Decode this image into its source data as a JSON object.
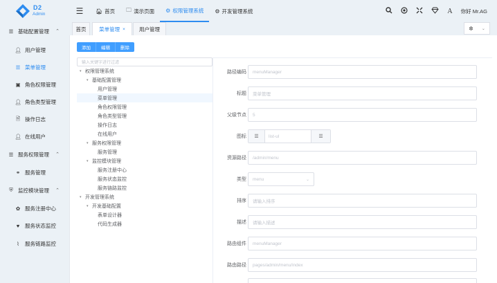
{
  "logo": {
    "title": "D2",
    "subtitle": "Admin"
  },
  "header": {
    "nav": [
      {
        "label": "首页",
        "icon": "home-icon",
        "glyph": "🏠︎"
      },
      {
        "label": "演示页面",
        "icon": "folder-icon",
        "glyph": "🗀"
      },
      {
        "label": "权限管理系统",
        "icon": "github-icon",
        "glyph": "⚙",
        "active": true
      },
      {
        "label": "开发管理系统",
        "icon": "gear-icon",
        "glyph": "⚙"
      }
    ],
    "user": "你好 Mr.AG"
  },
  "sidebar": {
    "items": [
      {
        "label": "基础配置管理",
        "type": "group",
        "icon": "list-icon",
        "glyph": "☰",
        "chevron": "⌃"
      },
      {
        "label": "用户管理",
        "type": "child",
        "icon": "user-icon",
        "glyph": "👤︎"
      },
      {
        "label": "菜单管理",
        "type": "child",
        "icon": "list-ul-icon",
        "glyph": "☰",
        "active": true
      },
      {
        "label": "角色权限管理",
        "type": "child",
        "icon": "id-card-icon",
        "glyph": "▣"
      },
      {
        "label": "角色类型管理",
        "type": "child",
        "icon": "user-secret-icon",
        "glyph": "👤︎"
      },
      {
        "label": "操作日志",
        "type": "child",
        "icon": "file-icon",
        "glyph": "🗎"
      },
      {
        "label": "在线用户",
        "type": "child",
        "icon": "user-icon",
        "glyph": "👤︎"
      },
      {
        "label": "服务权限管理",
        "type": "group",
        "icon": "list-icon",
        "glyph": "☰",
        "chevron": "⌃"
      },
      {
        "label": "服务管理",
        "type": "child",
        "icon": "share-icon",
        "glyph": "⚭"
      },
      {
        "label": "监控模块管理",
        "type": "group",
        "icon": "shield-icon",
        "glyph": "⛨",
        "chevron": "⌃"
      },
      {
        "label": "服务注册中心",
        "type": "child",
        "icon": "paw-icon",
        "glyph": "✿"
      },
      {
        "label": "服务状态监控",
        "type": "child",
        "icon": "heartbeat-icon",
        "glyph": "♥"
      },
      {
        "label": "服务链路监控",
        "type": "child",
        "icon": "line-chart-icon",
        "glyph": "⌇"
      }
    ]
  },
  "tabs": [
    {
      "label": "首页"
    },
    {
      "label": "菜单管理",
      "active": true,
      "close": "×"
    },
    {
      "label": "用户管理"
    }
  ],
  "toolbar": {
    "add": "添加",
    "edit": "编辑",
    "delete": "删除"
  },
  "tree": {
    "filter_placeholder": "输入关键字进行过滤",
    "nodes": [
      {
        "label": "权限管理系统",
        "level": 0,
        "expandable": true
      },
      {
        "label": "基础配置管理",
        "level": 1,
        "expandable": true
      },
      {
        "label": "用户管理",
        "level": 2
      },
      {
        "label": "菜单管理",
        "level": 2,
        "selected": true
      },
      {
        "label": "角色权限管理",
        "level": 2
      },
      {
        "label": "角色类型管理",
        "level": 2
      },
      {
        "label": "操作日志",
        "level": 2
      },
      {
        "label": "在线用户",
        "level": 2
      },
      {
        "label": "服务权限管理",
        "level": 1,
        "expandable": true
      },
      {
        "label": "服务管理",
        "level": 2
      },
      {
        "label": "监控模块管理",
        "level": 1,
        "expandable": true
      },
      {
        "label": "服务注册中心",
        "level": 2
      },
      {
        "label": "服务状态监控",
        "level": 2
      },
      {
        "label": "服务链路监控",
        "level": 2
      },
      {
        "label": "开发管理系统",
        "level": 0,
        "expandable": true
      },
      {
        "label": "开发基础配置",
        "level": 1,
        "expandable": true
      },
      {
        "label": "表单设计器",
        "level": 2
      },
      {
        "label": "代码生成器",
        "level": 2
      }
    ]
  },
  "form": {
    "code": {
      "label": "路径编码",
      "value": "menuManager"
    },
    "title": {
      "label": "标题",
      "value": "菜单管理"
    },
    "parent": {
      "label": "父级节点",
      "value": "5"
    },
    "icon": {
      "label": "图标",
      "value": "list-ul"
    },
    "resource": {
      "label": "资源路径",
      "value": "/admin/menu"
    },
    "type": {
      "label": "类型",
      "value": "menu"
    },
    "sort": {
      "label": "排序",
      "placeholder": "请输入排序"
    },
    "desc": {
      "label": "描述",
      "placeholder": "请输入描述"
    },
    "component": {
      "label": "路由组件",
      "value": "menuManager"
    },
    "route": {
      "label": "路由路径",
      "value": "pages/admin/menu/index"
    }
  },
  "colors": {
    "accent": "#2d8cf0",
    "button": "#409eff",
    "sidebar_bg": "#ebf1f6"
  }
}
